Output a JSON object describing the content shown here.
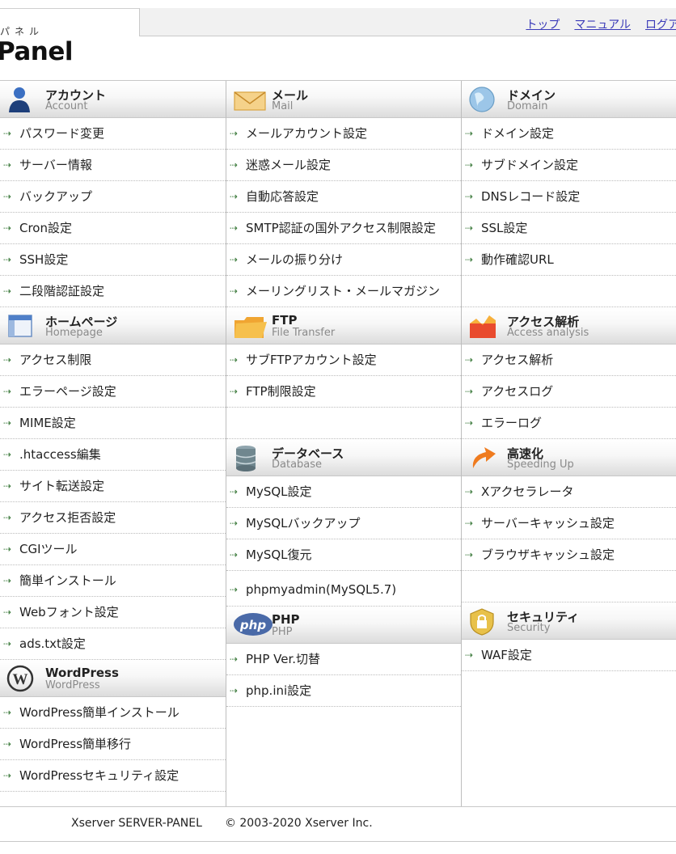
{
  "header": {
    "logo_sub": "パネル",
    "logo_main": "Panel",
    "nav": [
      "トップ",
      "マニュアル",
      "ログアウト"
    ]
  },
  "columns": [
    [
      {
        "title": "アカウント",
        "sub": "Account",
        "icon": "account-icon",
        "items": [
          "パスワード変更",
          "サーバー情報",
          "バックアップ",
          "Cron設定",
          "SSH設定",
          "二段階認証設定"
        ]
      },
      {
        "title": "ホームページ",
        "sub": "Homepage",
        "icon": "homepage-icon",
        "items": [
          "アクセス制限",
          "エラーページ設定",
          "MIME設定",
          ".htaccess編集",
          "サイト転送設定",
          "アクセス拒否設定",
          "CGIツール",
          "簡単インストール",
          "Webフォント設定",
          "ads.txt設定"
        ]
      },
      {
        "title": "WordPress",
        "sub": "WordPress",
        "icon": "wordpress-icon",
        "items": [
          "WordPress簡単インストール",
          "WordPress簡単移行",
          "WordPressセキュリティ設定"
        ]
      }
    ],
    [
      {
        "title": "メール",
        "sub": "Mail",
        "icon": "mail-icon",
        "items": [
          "メールアカウント設定",
          "迷惑メール設定",
          "自動応答設定",
          "SMTP認証の国外アクセス制限設定",
          "メールの振り分け",
          "メーリングリスト・メールマガジン"
        ]
      },
      {
        "title": "FTP",
        "sub": "File Transfer",
        "icon": "ftp-folder-icon",
        "items": [
          "サブFTPアカウント設定",
          "FTP制限設定",
          ""
        ]
      },
      {
        "title": "データベース",
        "sub": "Database",
        "icon": "database-icon",
        "items": [
          "MySQL設定",
          "MySQLバックアップ",
          "MySQL復元",
          "phpmyadmin(MySQL5.7)"
        ]
      },
      {
        "title": "PHP",
        "sub": "PHP",
        "icon": "php-icon",
        "items": [
          "PHP Ver.切替",
          "php.ini設定"
        ]
      }
    ],
    [
      {
        "title": "ドメイン",
        "sub": "Domain",
        "icon": "globe-icon",
        "items": [
          "ドメイン設定",
          "サブドメイン設定",
          "DNSレコード設定",
          "SSL設定",
          "動作確認URL",
          ""
        ]
      },
      {
        "title": "アクセス解析",
        "sub": "Access analysis",
        "icon": "analytics-icon",
        "items": [
          "アクセス解析",
          "アクセスログ",
          "エラーログ"
        ]
      },
      {
        "title": "高速化",
        "sub": "Speeding Up",
        "icon": "speed-arrow-icon",
        "items": [
          "Xアクセラレータ",
          "サーバーキャッシュ設定",
          "ブラウザキャッシュ設定",
          ""
        ]
      },
      {
        "title": "セキュリティ",
        "sub": "Security",
        "icon": "lock-icon",
        "items": [
          "WAF設定"
        ]
      }
    ]
  ],
  "footer": {
    "product": "Xserver SERVER-PANEL",
    "copyright": "© 2003-2020 Xserver Inc."
  },
  "colors": {
    "link": "#3a3ab8",
    "arrow": "#3c7a3c",
    "border": "#c8c8c8"
  }
}
